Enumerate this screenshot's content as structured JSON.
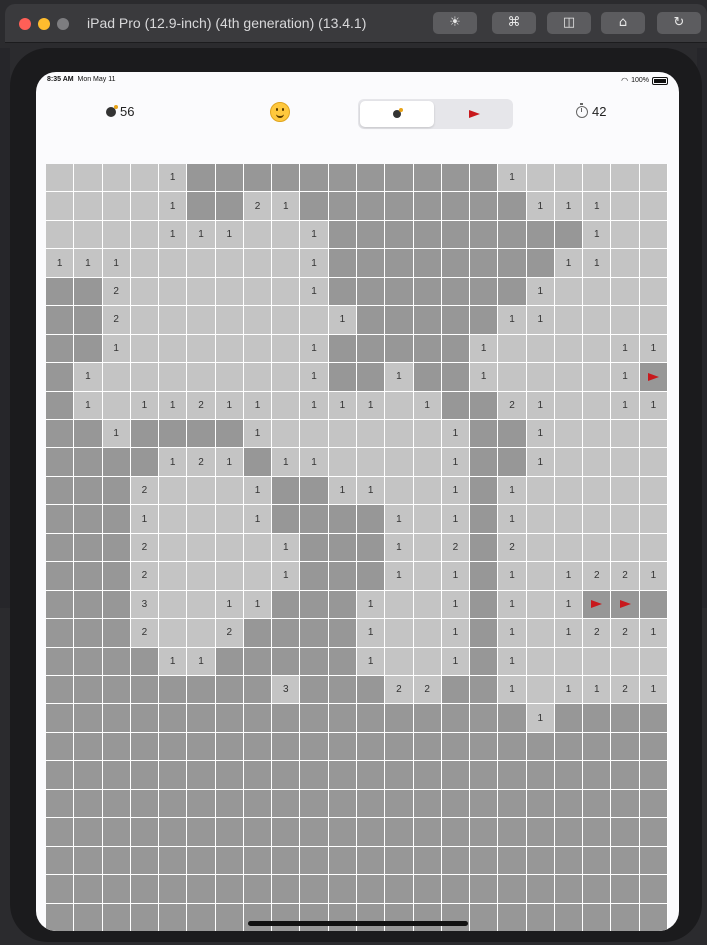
{
  "window": {
    "title": "iPad Pro (12.9-inch) (4th generation) (13.4.1)"
  },
  "status_bar": {
    "time": "8:35 AM",
    "date": "Mon May 11",
    "battery": "100%"
  },
  "game": {
    "mine_count": "56",
    "timer": "42",
    "mode_options": [
      "bomb",
      "flag"
    ],
    "selected_mode": "bomb",
    "smiley": "smiling-face-icon"
  },
  "board": {
    "cols": 22,
    "legend": {
      "H": "hidden",
      "F": "flagged",
      "0": "revealed-empty",
      "1-8": "revealed-number"
    },
    "rows": [
      "0000 1HHHHHHHH10000000",
      "00001HH21HHHHHH01110000",
      "00001110 1HHHHHH0010",
      "1110 0000 1HHHHHH0110",
      "HH2 0000 1HHHHHH1000",
      "HH2 00000 1HHHHH11000",
      "HH1 00000 1HHHH1000011",
      "H1000000 1HH1HH1000 1F",
      "H1 0112110 111 01HH21 0 011",
      "HH1HHHHH1 0000 0 1HH1",
      "HHHH121H11 000 0 1HH1",
      "HHH2 000 1HH11 01H1",
      "HHH1 000 1HHH1 01H1",
      "HHH2 0000 1HHH1 02H2",
      "HHH2 0000 1HHH1 01H1",
      "HHH3 0 011HHH1 01H1 01FFH",
      "HHH2 000 2HHHH1 01H1 01221",
      "HHHH11HHHHHH1 01H1",
      "HHHHHHHH3HHH22HH1 01121",
      "HHHHHHHHHHHHHHHHH1HHHH",
      "HHHHHHHHHHHHHHHHHHHHHH"
    ],
    "grid": [
      [
        "0",
        "0",
        "0",
        "0",
        "1",
        "H",
        "H",
        "H",
        "H",
        "H",
        "H",
        "H",
        "H",
        "H",
        "H",
        "H",
        "1",
        "0",
        "0",
        "0",
        "0",
        "0"
      ],
      [
        "0",
        "0",
        "0",
        "0",
        "1",
        "H",
        "H",
        "2",
        "1",
        "H",
        "H",
        "H",
        "H",
        "H",
        "H",
        "H",
        "H",
        "1",
        "1",
        "1",
        "0",
        "0"
      ],
      [
        "0",
        "0",
        "0",
        "0",
        "1",
        "1",
        "1",
        "0",
        "0",
        "1",
        "H",
        "H",
        "H",
        "H",
        "H",
        "H",
        "H",
        "H",
        "H",
        "1",
        "0",
        "0"
      ],
      [
        "1",
        "1",
        "1",
        "0",
        "0",
        "0",
        "0",
        "0",
        "0",
        "1",
        "H",
        "H",
        "H",
        "H",
        "H",
        "H",
        "H",
        "H",
        "1",
        "1",
        "0",
        "0"
      ],
      [
        "H",
        "H",
        "2",
        "0",
        "0",
        "0",
        "0",
        "0",
        "0",
        "1",
        "H",
        "H",
        "H",
        "H",
        "H",
        "H",
        "H",
        "1",
        "0",
        "0",
        "0",
        "0"
      ],
      [
        "H",
        "H",
        "2",
        "0",
        "0",
        "0",
        "0",
        "0",
        "0",
        "0",
        "1",
        "H",
        "H",
        "H",
        "H",
        "H",
        "1",
        "1",
        "0",
        "0",
        "0",
        "0"
      ],
      [
        "H",
        "H",
        "1",
        "0",
        "0",
        "0",
        "0",
        "0",
        "0",
        "1",
        "H",
        "H",
        "H",
        "H",
        "H",
        "1",
        "0",
        "0",
        "0",
        "0",
        "1",
        "1"
      ],
      [
        "H",
        "1",
        "0",
        "0",
        "0",
        "0",
        "0",
        "0",
        "0",
        "1",
        "H",
        "H",
        "1",
        "H",
        "H",
        "1",
        "0",
        "0",
        "0",
        "0",
        "1",
        "F"
      ],
      [
        "H",
        "1",
        "0",
        "1",
        "1",
        "2",
        "1",
        "1",
        "0",
        "1",
        "1",
        "1",
        "0",
        "1",
        "H",
        "H",
        "2",
        "1",
        "0",
        "0",
        "1",
        "1"
      ],
      [
        "H",
        "H",
        "1",
        "H",
        "H",
        "H",
        "H",
        "1",
        "0",
        "0",
        "0",
        "0",
        "0",
        "0",
        "1",
        "H",
        "H",
        "1",
        "0",
        "0",
        "0",
        "0"
      ],
      [
        "H",
        "H",
        "H",
        "H",
        "1",
        "2",
        "1",
        "H",
        "1",
        "1",
        "0",
        "0",
        "0",
        "0",
        "1",
        "H",
        "H",
        "1",
        "0",
        "0",
        "0",
        "0"
      ],
      [
        "H",
        "H",
        "H",
        "2",
        "0",
        "0",
        "0",
        "1",
        "H",
        "H",
        "1",
        "1",
        "0",
        "0",
        "1",
        "H",
        "1",
        "0",
        "0",
        "0",
        "0",
        "0"
      ],
      [
        "H",
        "H",
        "H",
        "1",
        "0",
        "0",
        "0",
        "1",
        "H",
        "H",
        "H",
        "H",
        "1",
        "0",
        "1",
        "H",
        "1",
        "0",
        "0",
        "0",
        "0",
        "0"
      ],
      [
        "H",
        "H",
        "H",
        "2",
        "0",
        "0",
        "0",
        "0",
        "1",
        "H",
        "H",
        "H",
        "1",
        "0",
        "2",
        "H",
        "2",
        "0",
        "0",
        "0",
        "0",
        "0"
      ],
      [
        "H",
        "H",
        "H",
        "2",
        "0",
        "0",
        "0",
        "0",
        "1",
        "H",
        "H",
        "H",
        "1",
        "0",
        "1",
        "H",
        "1",
        "0",
        "1",
        "2",
        "2",
        "1"
      ],
      [
        "H",
        "H",
        "H",
        "3",
        "0",
        "0",
        "1",
        "1",
        "H",
        "H",
        "H",
        "1",
        "0",
        "0",
        "1",
        "H",
        "1",
        "0",
        "1",
        "F",
        "F",
        "H"
      ],
      [
        "H",
        "H",
        "H",
        "2",
        "0",
        "0",
        "2",
        "H",
        "H",
        "H",
        "H",
        "1",
        "0",
        "0",
        "1",
        "H",
        "1",
        "0",
        "1",
        "2",
        "2",
        "1"
      ],
      [
        "H",
        "H",
        "H",
        "H",
        "1",
        "1",
        "H",
        "H",
        "H",
        "H",
        "H",
        "1",
        "0",
        "0",
        "1",
        "H",
        "1",
        "0",
        "0",
        "0",
        "0",
        "0"
      ],
      [
        "H",
        "H",
        "H",
        "H",
        "H",
        "H",
        "H",
        "H",
        "3",
        "H",
        "H",
        "H",
        "2",
        "2",
        "H",
        "H",
        "1",
        "0",
        "1",
        "1",
        "2",
        "1"
      ],
      [
        "H",
        "H",
        "H",
        "H",
        "H",
        "H",
        "H",
        "H",
        "H",
        "H",
        "H",
        "H",
        "H",
        "H",
        "H",
        "H",
        "H",
        "1",
        "H",
        "H",
        "H",
        "H"
      ],
      [
        "H",
        "H",
        "H",
        "H",
        "H",
        "H",
        "H",
        "H",
        "H",
        "H",
        "H",
        "H",
        "H",
        "H",
        "H",
        "H",
        "H",
        "H",
        "H",
        "H",
        "H",
        "H"
      ],
      [
        "H",
        "H",
        "H",
        "H",
        "H",
        "H",
        "H",
        "H",
        "H",
        "H",
        "H",
        "H",
        "H",
        "H",
        "H",
        "H",
        "H",
        "H",
        "H",
        "H",
        "H",
        "H"
      ],
      [
        "H",
        "H",
        "H",
        "H",
        "H",
        "H",
        "H",
        "H",
        "H",
        "H",
        "H",
        "H",
        "H",
        "H",
        "H",
        "H",
        "H",
        "H",
        "H",
        "H",
        "H",
        "H"
      ],
      [
        "H",
        "H",
        "H",
        "H",
        "H",
        "H",
        "H",
        "H",
        "H",
        "H",
        "H",
        "H",
        "H",
        "H",
        "H",
        "H",
        "H",
        "H",
        "H",
        "H",
        "H",
        "H"
      ],
      [
        "H",
        "H",
        "H",
        "H",
        "H",
        "H",
        "H",
        "H",
        "H",
        "H",
        "H",
        "H",
        "H",
        "H",
        "H",
        "H",
        "H",
        "H",
        "H",
        "H",
        "H",
        "H"
      ],
      [
        "H",
        "H",
        "H",
        "H",
        "H",
        "H",
        "H",
        "H",
        "H",
        "H",
        "H",
        "H",
        "H",
        "H",
        "H",
        "H",
        "H",
        "H",
        "H",
        "H",
        "H",
        "H"
      ],
      [
        "H",
        "H",
        "H",
        "H",
        "H",
        "H",
        "H",
        "H",
        "H",
        "H",
        "H",
        "H",
        "H",
        "H",
        "H",
        "H",
        "H",
        "H",
        "H",
        "H",
        "H",
        "H"
      ]
    ]
  }
}
